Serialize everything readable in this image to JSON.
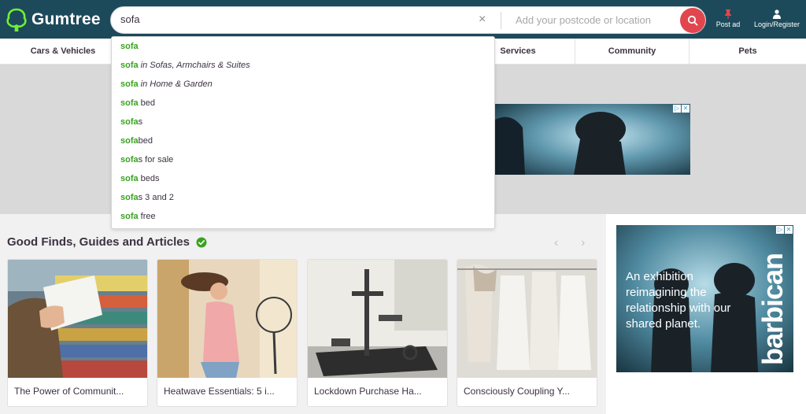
{
  "header": {
    "logo_text": "Gumtree",
    "search_value": "sofa",
    "clear_label": "×",
    "location_placeholder": "Add your postcode or location",
    "post_ad_label": "Post ad",
    "login_label": "Login/Register",
    "colors": {
      "header_bg": "#1d4a5b",
      "search_button": "#e1464e",
      "brand_green": "#72ef36"
    }
  },
  "nav": {
    "items": [
      {
        "label": "Cars & Vehicles"
      },
      {
        "label": "Services"
      },
      {
        "label": "Community"
      },
      {
        "label": "Pets"
      }
    ]
  },
  "autocomplete": {
    "highlight_color": "#38a31f",
    "suggestions": [
      {
        "match": "sofa",
        "rest": "",
        "rest_italic": ""
      },
      {
        "match": "sofa",
        "rest": "",
        "rest_italic": " in Sofas, Armchairs & Suites"
      },
      {
        "match": "sofa",
        "rest": "",
        "rest_italic": " in Home & Garden"
      },
      {
        "match": "sofa",
        "rest": " bed",
        "rest_italic": ""
      },
      {
        "match": "sofa",
        "rest": "s",
        "rest_italic": ""
      },
      {
        "match": "sofa",
        "rest": "bed",
        "rest_italic": ""
      },
      {
        "match": "sofa",
        "rest": "s for sale",
        "rest_italic": ""
      },
      {
        "match": "sofa",
        "rest": " beds",
        "rest_italic": ""
      },
      {
        "match": "sofa",
        "rest": "s 3 and 2",
        "rest_italic": ""
      },
      {
        "match": "sofa",
        "rest": " free",
        "rest_italic": ""
      }
    ]
  },
  "good_finds": {
    "title": "Good Finds, Guides and Articles",
    "prev_arrow": "‹",
    "next_arrow": "›",
    "cards": [
      {
        "title": "The Power of Communit..."
      },
      {
        "title": "Heatwave Essentials: 5 i..."
      },
      {
        "title": "Lockdown Purchase Ha..."
      },
      {
        "title": "Consciously Coupling Y..."
      }
    ]
  },
  "side_ad": {
    "text": "An exhibition reimagining the relationship with our shared planet.",
    "brand": "barbican",
    "adchoice_info": "▷",
    "adchoice_close": "✕"
  }
}
